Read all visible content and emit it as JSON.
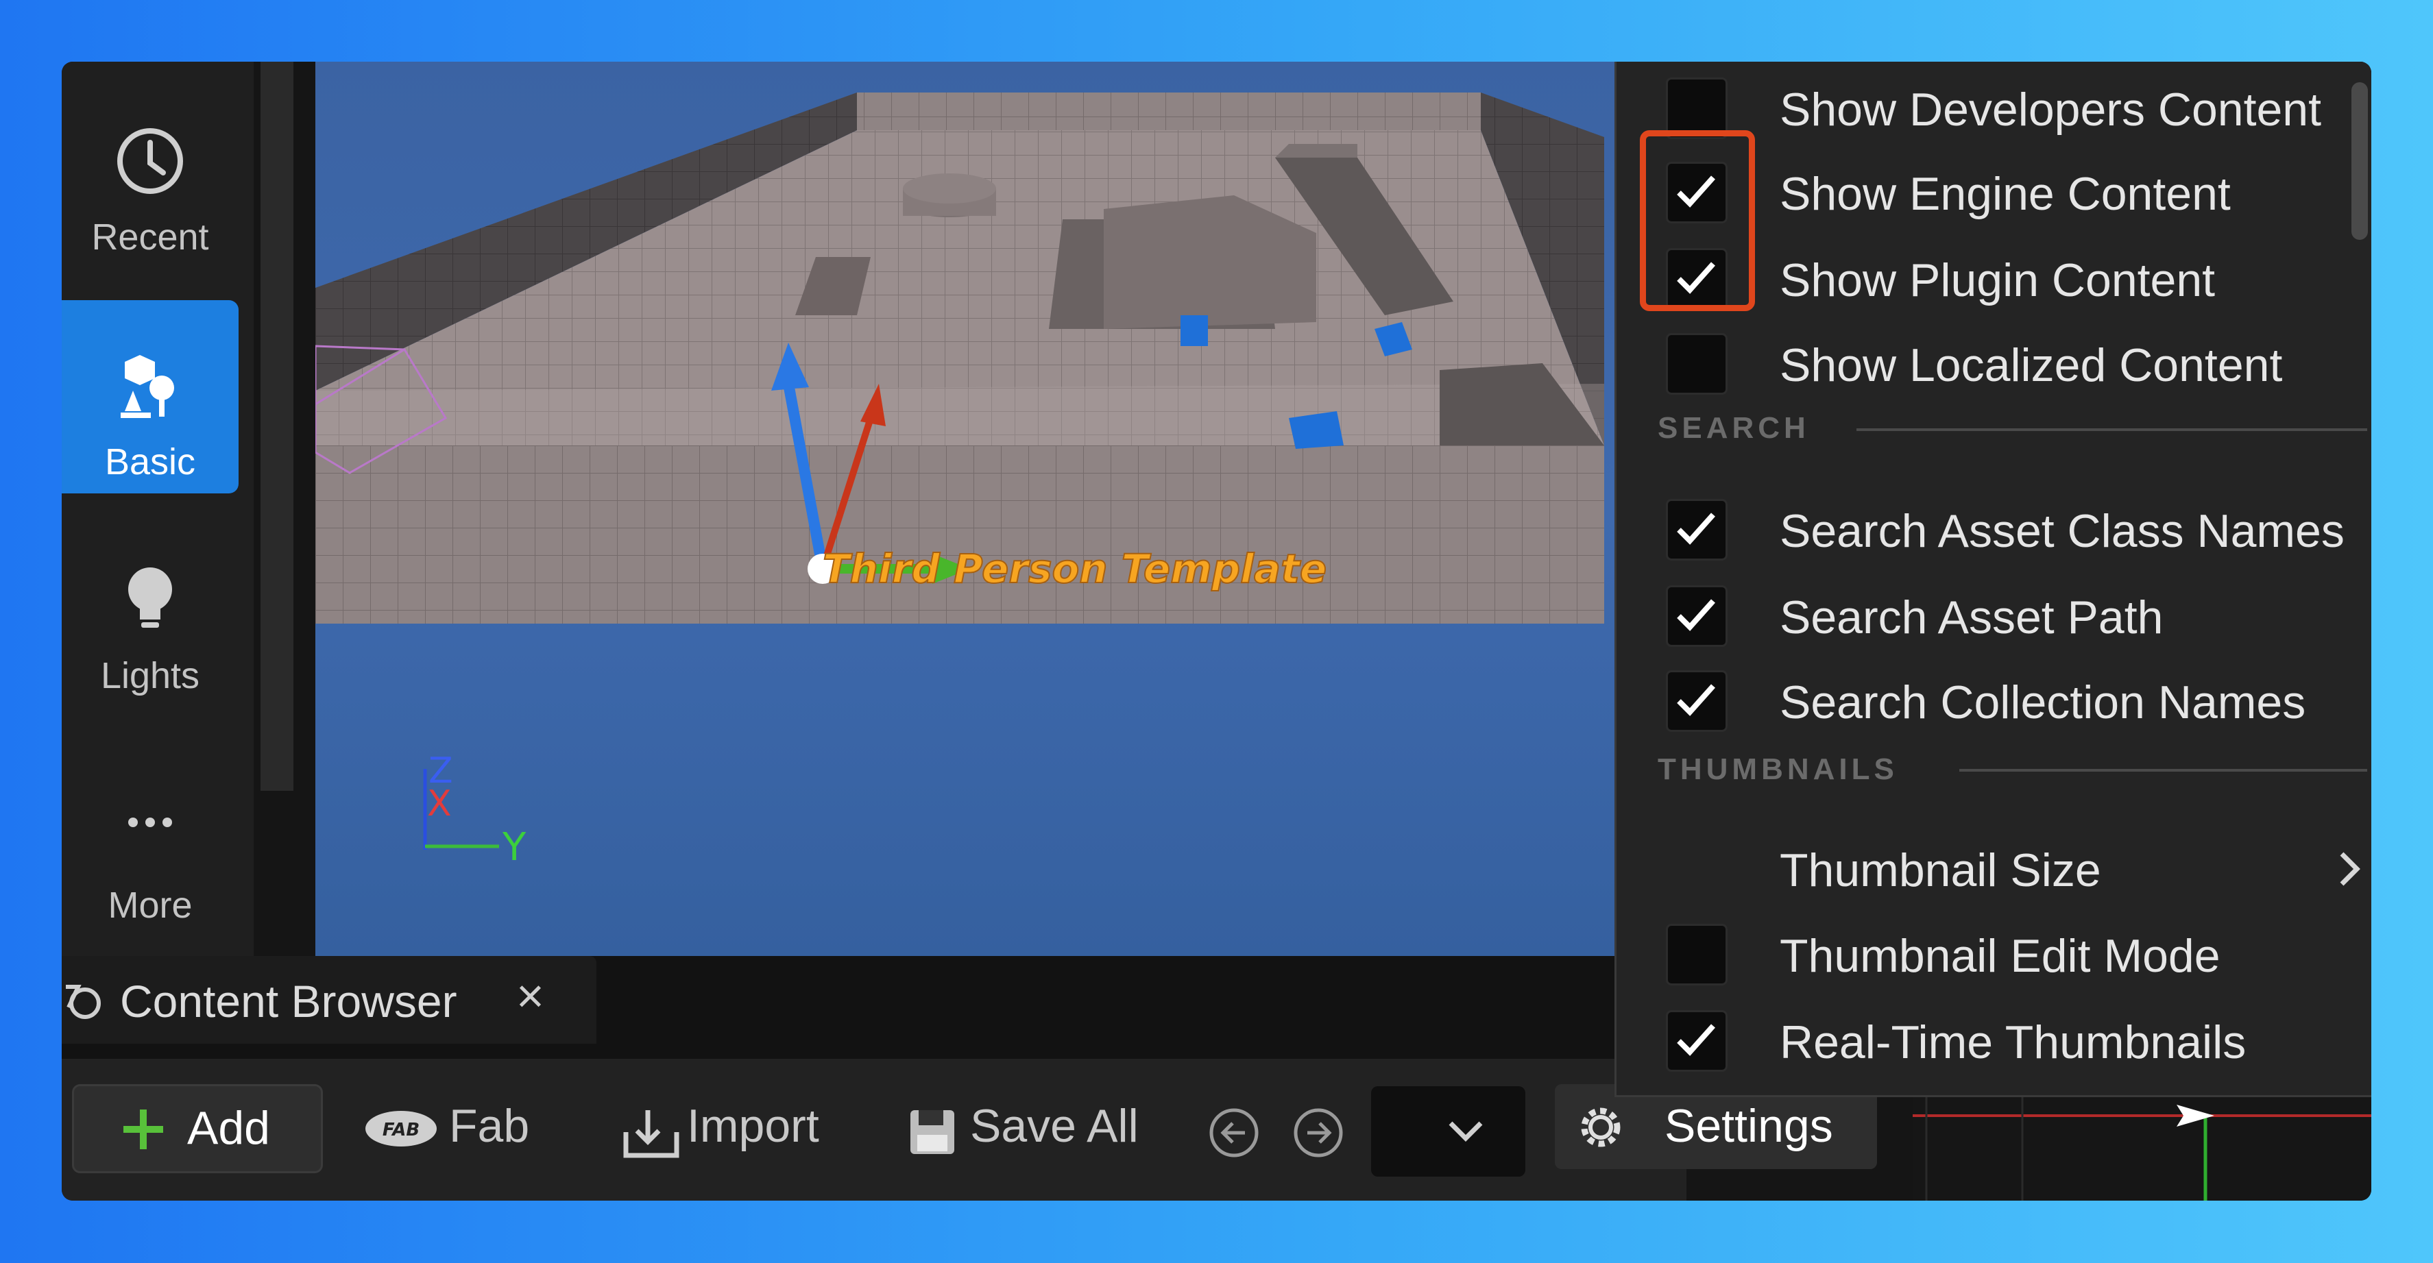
{
  "modes": [
    {
      "label": "Recent",
      "icon": "clock-icon"
    },
    {
      "label": "Basic",
      "icon": "basic-shapes-icon"
    },
    {
      "label": "Lights",
      "icon": "lightbulb-icon"
    },
    {
      "label": "More",
      "icon": "more-dots-icon"
    }
  ],
  "viewport": {
    "actor_label": "Third Person Template",
    "axis_z": "Z",
    "axis_x": "X",
    "axis_y": "Y"
  },
  "tab": {
    "title": "Content Browser",
    "close": "×",
    "icon": "content-browser-icon"
  },
  "toolbar": {
    "add": "Add",
    "fab": "Fab",
    "import": "Import",
    "save_all": "Save All",
    "settings": "Settings",
    "back_icon": "back-arrow-icon",
    "forward_icon": "forward-arrow-icon",
    "dropdown_icon": "chevron-down-icon"
  },
  "menu": {
    "items_top": [
      {
        "label": "Show Developers Content",
        "checked": false
      },
      {
        "label": "Show Engine Content",
        "checked": true
      },
      {
        "label": "Show Plugin Content",
        "checked": true
      },
      {
        "label": "Show Localized Content",
        "checked": false
      }
    ],
    "section_search": "SEARCH",
    "items_search": [
      {
        "label": "Search Asset Class Names",
        "checked": true
      },
      {
        "label": "Search Asset Path",
        "checked": true
      },
      {
        "label": "Search Collection Names",
        "checked": true
      }
    ],
    "section_thumbnails": "THUMBNAILS",
    "thumbnail_size": "Thumbnail Size",
    "items_thumbs": [
      {
        "label": "Thumbnail Edit Mode",
        "checked": false
      },
      {
        "label": "Real-Time Thumbnails",
        "checked": true
      }
    ]
  },
  "colors": {
    "highlight": "#e0461c",
    "active_mode": "#1d7fe0",
    "background_left": "#1f76f2",
    "background_right": "#4fc6fb"
  }
}
